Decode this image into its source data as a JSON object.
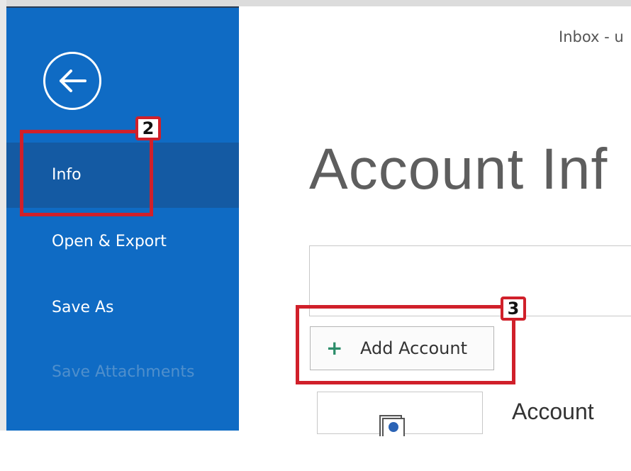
{
  "window": {
    "title": "Inbox - u"
  },
  "sidebar": {
    "back_icon": "arrow-left-circle-icon",
    "items": [
      {
        "label": "Info",
        "state": "selected"
      },
      {
        "label": "Open & Export",
        "state": "normal"
      },
      {
        "label": "Save As",
        "state": "normal"
      },
      {
        "label": "Save Attachments",
        "state": "disabled"
      },
      {
        "label": "",
        "state": "partially-visible"
      }
    ]
  },
  "main": {
    "page_title": "Account Inf",
    "add_account_icon": "plus-icon",
    "add_account_label": "Add Account",
    "settings_section_heading": "Account"
  },
  "annotations": [
    {
      "number": "2",
      "target": "Info"
    },
    {
      "number": "3",
      "target": "Add Account"
    }
  ],
  "colors": {
    "sidebar": "#0f6bc4",
    "sidebar_selected": "#145aa3",
    "callout_red": "#d0202a",
    "plus_green": "#2c8d6a"
  }
}
